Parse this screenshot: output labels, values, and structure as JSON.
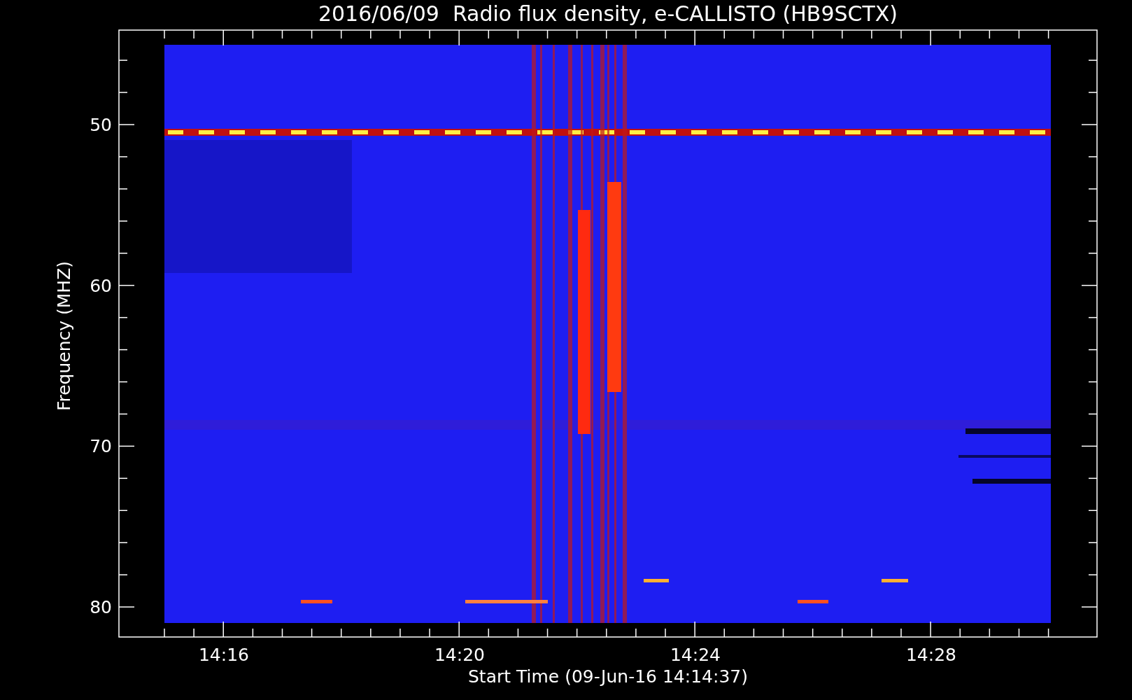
{
  "title": "2016/06/09  Radio flux density, e-CALLISTO (HB9SCTX)",
  "y_axis": {
    "label": "Frequency (MHZ)",
    "ticks": [
      "50",
      "60",
      "70",
      "80"
    ]
  },
  "x_axis": {
    "label": "Start Time (09-Jun-16 14:14:37)",
    "ticks": [
      "14:16",
      "14:20",
      "14:24",
      "14:28"
    ]
  }
}
